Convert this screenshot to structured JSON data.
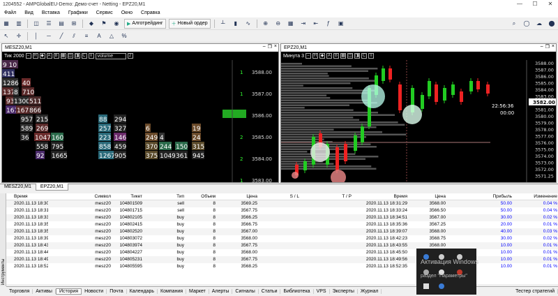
{
  "window": {
    "title": "1204552 - AMPGlobalEU-Demo: Демо-счет - Netting - EPZ20,M1"
  },
  "menu": [
    "Файл",
    "Вид",
    "Вставка",
    "Графики",
    "Сервис",
    "Окно",
    "Справка"
  ],
  "toolbar": {
    "algo": "Алготрейдинг",
    "new_order": "Новый ордер"
  },
  "left_chart": {
    "title": "MESZ20,M1",
    "mode": "Тик",
    "count": "2000",
    "volume_select": "volume",
    "num": "2",
    "price_levels": [
      "3588.00",
      "3587.00",
      "3586.00",
      "3585.00",
      "3584.00",
      "3583.00"
    ],
    "dom_values": [
      "1",
      "1",
      "11",
      "2",
      "2",
      "1"
    ],
    "cells": [
      {
        "t": "9 10"
      },
      {
        "t": "411"
      },
      {
        "t": "1286"
      },
      {
        "t": "40"
      },
      {
        "t": "1374"
      },
      {
        "t": "8"
      },
      {
        "t": "710"
      },
      {
        "t": "937"
      },
      {
        "t": "1300"
      },
      {
        "t": "511"
      },
      {
        "t": "167"
      },
      {
        "t": "1676"
      },
      {
        "t": "866"
      },
      {
        "t": "957"
      },
      {
        "t": "215"
      },
      {
        "t": "589"
      },
      {
        "t": "269"
      },
      {
        "t": "36"
      },
      {
        "t": "1047"
      },
      {
        "t": "160"
      },
      {
        "t": "558"
      },
      {
        "t": "795"
      },
      {
        "t": "92"
      },
      {
        "t": "1665"
      },
      {
        "t": "88"
      },
      {
        "t": "294"
      },
      {
        "t": "257"
      },
      {
        "t": "327"
      },
      {
        "t": "223"
      },
      {
        "t": "146"
      },
      {
        "t": "858"
      },
      {
        "t": "459"
      },
      {
        "t": "1267"
      },
      {
        "t": "905"
      },
      {
        "t": "6"
      },
      {
        "t": "249"
      },
      {
        "t": "4"
      },
      {
        "t": "370"
      },
      {
        "t": "244"
      },
      {
        "t": "150"
      },
      {
        "t": "315"
      },
      {
        "t": "375"
      },
      {
        "t": "1049"
      },
      {
        "t": "361"
      },
      {
        "t": "945"
      },
      {
        "t": "19"
      },
      {
        "t": "24"
      }
    ]
  },
  "right_chart": {
    "title": "EPZ20,M1",
    "mode": "Минута",
    "num": "3",
    "price_levels": [
      "3588.00",
      "3587.00",
      "3586.00",
      "3585.00",
      "3584.00",
      "3583.00",
      "3582.00",
      "3581.00",
      "3580.00",
      "3579.00",
      "3578.00",
      "3577.00",
      "3576.00",
      "3575.00",
      "3574.00",
      "3573.00",
      "3572.00",
      "3571.25"
    ],
    "current_price": "3582.00",
    "timer": "22:56:36",
    "timer2": "00:00"
  },
  "chart_tabs": [
    "MESZ20,M1",
    "EPZ20,M1"
  ],
  "table": {
    "headers": [
      "Время",
      "Символ",
      "Тикет",
      "Тип",
      "Объем",
      "Цена",
      "S / L",
      "T / P",
      "Время",
      "Цена",
      "Прибыль",
      "Изменение"
    ],
    "rows": [
      [
        "2020.11.13 18:30:15",
        "mesz20",
        "104801509",
        "sell",
        "8",
        "3569.25",
        "",
        "",
        "2020.11.13 18:31:29",
        "3568.00",
        "50.00",
        "0.04 %"
      ],
      [
        "2020.11.13 18:31:40",
        "mesz20",
        "104801715",
        "sell",
        "8",
        "3567.75",
        "",
        "",
        "2020.11.13 18:33:24",
        "3566.50",
        "50.00",
        "0.04 %"
      ],
      [
        "2020.11.13 18:33:59",
        "mesz20",
        "104802105",
        "buy",
        "8",
        "3566.25",
        "",
        "",
        "2020.11.13 18:34:51",
        "3567.00",
        "30.00",
        "0.02 %"
      ],
      [
        "2020.11.13 18:35:12",
        "mesz20",
        "104802415",
        "buy",
        "8",
        "3566.75",
        "",
        "",
        "2020.11.13 18:35:36",
        "3567.25",
        "20.00",
        "0.01 %"
      ],
      [
        "2020.11.13 18:35:50",
        "mesz20",
        "104802520",
        "buy",
        "8",
        "3567.00",
        "",
        "",
        "2020.11.13 18:39:07",
        "3568.00",
        "40.00",
        "0.03 %"
      ],
      [
        "2020.11.13 18:39:22",
        "mesz20",
        "104803072",
        "buy",
        "8",
        "3568.00",
        "",
        "",
        "2020.11.13 18:42:23",
        "3568.75",
        "30.00",
        "0.02 %"
      ],
      [
        "2020.11.13 18:43:10",
        "mesz20",
        "104803974",
        "buy",
        "8",
        "3567.75",
        "",
        "",
        "2020.11.13 18:43:55",
        "3568.00",
        "10.00",
        "0.01 %"
      ],
      [
        "2020.11.13 18:44:26",
        "mesz20",
        "104804227",
        "buy",
        "8",
        "3568.00",
        "",
        "",
        "2020.11.13 18:45:50",
        "3568.25",
        "10.00",
        "0.01 %"
      ],
      [
        "2020.11.13 18:49:47",
        "mesz20",
        "104805231",
        "buy",
        "8",
        "3567.75",
        "",
        "",
        "2020.11.13 18:49:56",
        "3568.00",
        "10.00",
        "0.01 %"
      ],
      [
        "2020.11.13 18:52:01",
        "mesz20",
        "104805595",
        "buy",
        "8",
        "3568.25",
        "",
        "",
        "2020.11.13 18:52:35",
        "3568.50",
        "10.00",
        "0.01 %"
      ]
    ]
  },
  "side_label": "Инструменты",
  "bottom_tabs": [
    "Торговля",
    "Активы",
    "История",
    "Новости",
    "Почта",
    "Календарь",
    "Компания",
    "Маркет",
    "Алерты",
    "Сигналы",
    "Статьи",
    "Библиотека",
    "VPS",
    "Эксперты",
    "Журнал"
  ],
  "bottom_right": "Тестер стратегий",
  "watermark": {
    "line1": "Активация Windows",
    "line2": "раздел \"Параметры\""
  }
}
